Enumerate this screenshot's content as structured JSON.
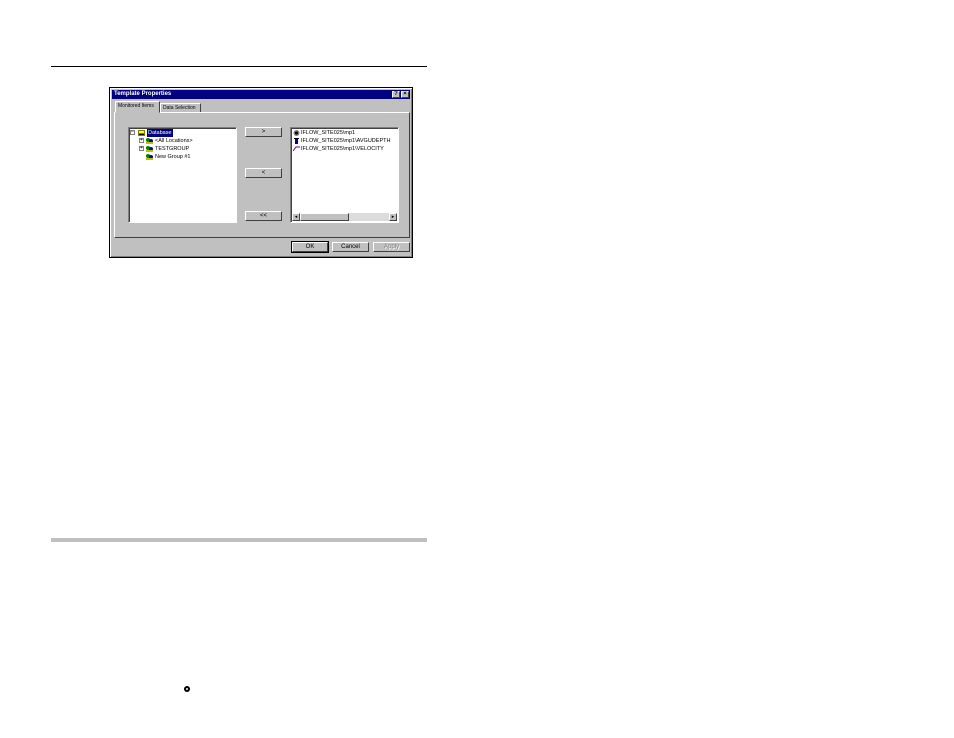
{
  "dialog": {
    "title": "Template Properties",
    "help_button": "?",
    "close_button": "×",
    "tabs": [
      {
        "label": "Monitored Items"
      },
      {
        "label": "Data Selection"
      }
    ],
    "tree": [
      {
        "label": "Database",
        "expander": "−"
      },
      {
        "label": "<All Locations>",
        "expander": "+"
      },
      {
        "label": "TESTGROUP",
        "expander": "+"
      },
      {
        "label": "New Group #1",
        "expander": ""
      }
    ],
    "transfer_buttons": {
      "add": ">",
      "remove": "<",
      "remove_all": "<<"
    },
    "monitored_items": [
      {
        "label": "IFLOW_SITE025\\mp1",
        "icon": "site-icon"
      },
      {
        "label": "IFLOW_SITE025\\mp1\\AVGUDEPTH",
        "icon": "depth-gauge-icon"
      },
      {
        "label": "IFLOW_SITE025\\mp1\\VELOCITY",
        "icon": "velocity-icon"
      }
    ],
    "scroll_left": "◂",
    "scroll_right": "▸",
    "footer": {
      "ok": "OK",
      "cancel": "Cancel",
      "apply": "Apply"
    }
  }
}
